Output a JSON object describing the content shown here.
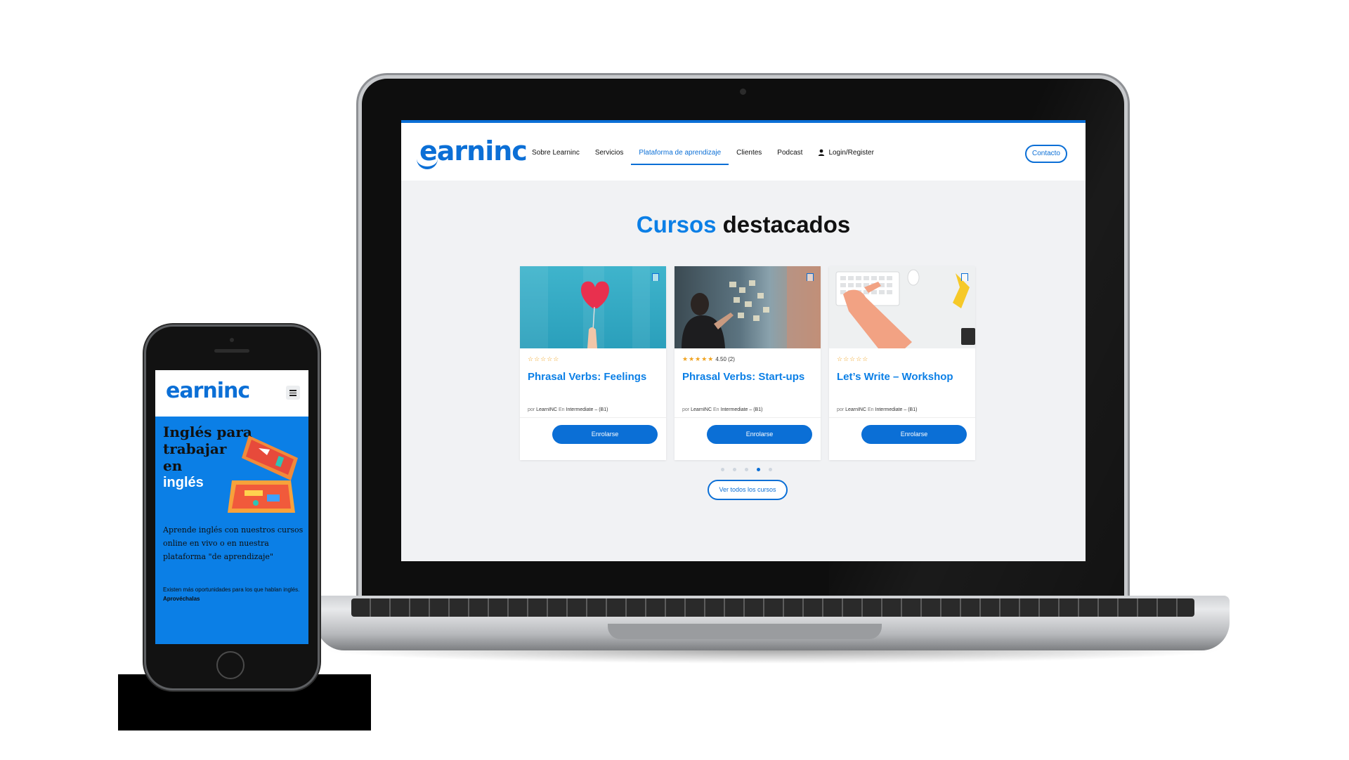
{
  "laptop_site": {
    "logo": "earninc",
    "nav": {
      "items": [
        "Sobre Learninc",
        "Servicios",
        "Plataforma de aprendizaje",
        "Clientes",
        "Podcast"
      ],
      "active": "Plataforma de aprendizaje",
      "login": "Login/Register"
    },
    "contact_button": "Contacto",
    "section_title": {
      "highlight": "Cursos",
      "rest": "destacados"
    },
    "cards": [
      {
        "title": "Phrasal Verbs: Feelings",
        "stars": "☆☆☆☆☆",
        "rating": "",
        "meta_by": "por",
        "author": "LearnINC",
        "meta_in": "En",
        "level": "Intermediate – (B1)",
        "button": "Enrolarse",
        "image": "heart-image"
      },
      {
        "title": "Phrasal Verbs: Start-ups",
        "stars": "★★★★★",
        "rating": "4.50 (2)",
        "meta_by": "por",
        "author": "LearnINC",
        "meta_in": "En",
        "level": "Intermediate – (B1)",
        "button": "Enrolarse",
        "image": "startup-image"
      },
      {
        "title": "Let’s Write – Workshop",
        "stars": "☆☆☆☆☆",
        "rating": "",
        "meta_by": "por",
        "author": "LearnINC",
        "meta_in": "En",
        "level": "Intermediate – (B1)",
        "button": "Enrolarse",
        "image": "keyboard-image"
      }
    ],
    "carousel": {
      "count": 5,
      "active_index": 3
    },
    "all_courses_button": "Ver todos los cursos"
  },
  "mobile_site": {
    "logo": "earninc",
    "title_lines": [
      "Inglés para",
      "trabajar",
      "en"
    ],
    "title_highlight": "inglés",
    "description": "Aprende inglés con nuestros cursos online en vivo o en nuestra plataforma \"de aprendizaje\"",
    "note": "Existen más oportunidades para los que hablan inglés.",
    "note_bold": "Aprovéchalas"
  },
  "colors": {
    "brand_blue": "#0b6fd6",
    "accent_blue": "#0b7fe6",
    "star": "#f0a320"
  },
  "icons": [
    "user-icon",
    "bookmark-icon",
    "menu-icon",
    "suitcase-illustration"
  ]
}
